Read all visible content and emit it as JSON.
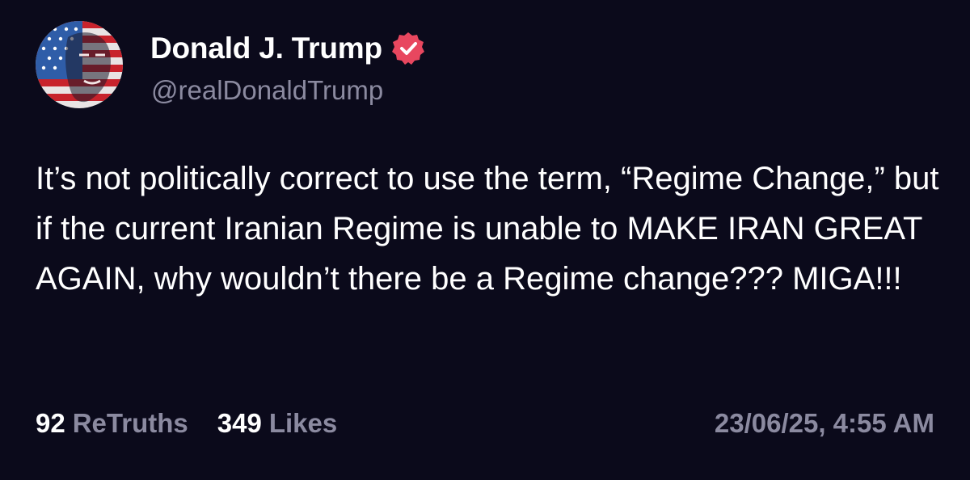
{
  "post": {
    "author": {
      "display_name": "Donald J. Trump",
      "handle": "@realDonaldTrump",
      "verified": true,
      "verified_badge_color": "#e8475f",
      "avatar_icon": "flag-portrait-avatar"
    },
    "text": "It’s not politically correct to use the term, “Regime Change,” but if the current Iranian Regime is unable to MAKE IRAN GREAT AGAIN, why wouldn’t there be a Regime change??? MIGA!!!",
    "stats": {
      "retruths_count": "92",
      "retruths_label": "ReTruths",
      "likes_count": "349",
      "likes_label": "Likes"
    },
    "timestamp": "23/06/25, 4:55 AM"
  },
  "theme": {
    "background": "#0b0a1b",
    "primary_text": "#ffffff",
    "secondary_text": "#8b8aa0"
  }
}
